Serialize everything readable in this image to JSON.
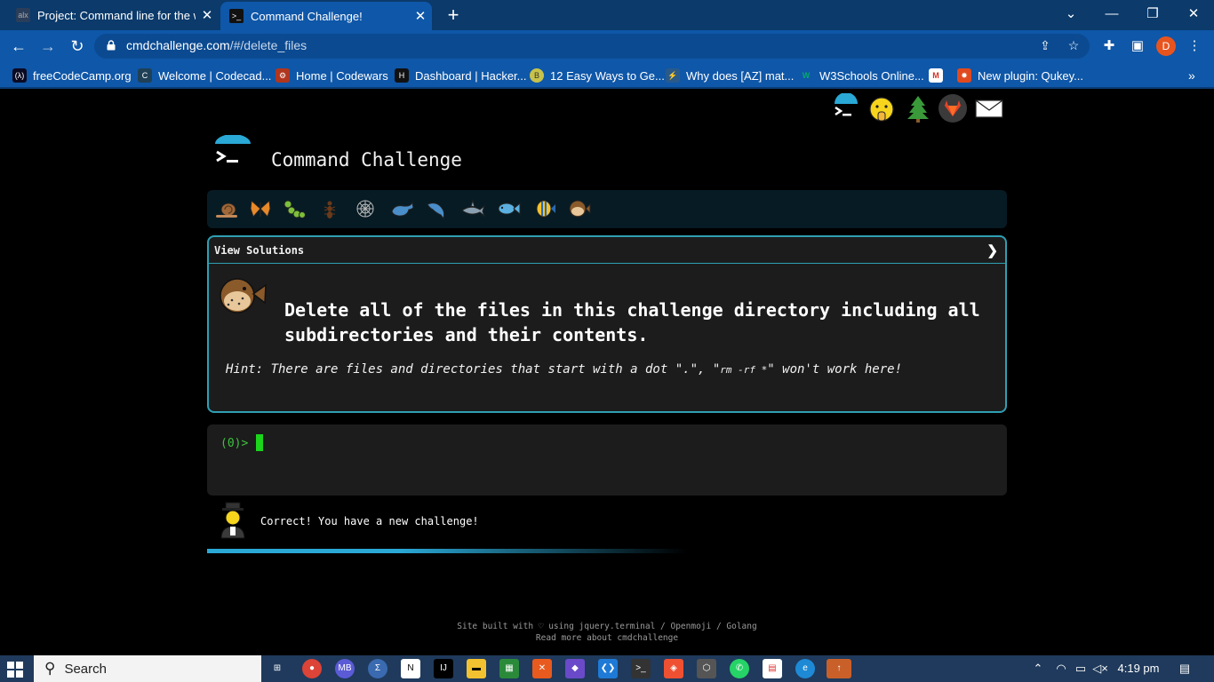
{
  "browser": {
    "tabs": [
      {
        "title": "Project: Command line for the wi",
        "favicon_text": "alx",
        "active": false
      },
      {
        "title": "Command Challenge!",
        "favicon_text": ">_",
        "active": true
      }
    ],
    "new_tab": "+",
    "url_host": "cmdchallenge.com",
    "url_path": "/#/delete_files",
    "profile_initial": "D",
    "bookmarks": [
      {
        "label": "freeCodeCamp.org",
        "icon": "fcc-icon",
        "icon_text": "(λ)",
        "color": "#0a0a23"
      },
      {
        "label": "Welcome | Codecad...",
        "icon": "codecademy-icon",
        "icon_text": "C",
        "color": "#1f4056"
      },
      {
        "label": "Home | Codewars",
        "icon": "codewars-icon",
        "icon_text": "⚙",
        "color": "#b1361e"
      },
      {
        "label": "Dashboard | Hacker...",
        "icon": "hackerrank-icon",
        "icon_text": "H",
        "color": "#111111"
      },
      {
        "label": "12 Easy Ways to Ge...",
        "icon": "article-icon",
        "icon_text": "B",
        "color": "#c8c24a"
      },
      {
        "label": "Why does [AZ] mat...",
        "icon": "stackoverflow-icon",
        "icon_text": "⚡",
        "color": "#2a5a8a"
      },
      {
        "label": "W3Schools Online...",
        "icon": "w3schools-icon",
        "icon_text": "W",
        "color": "#04aa6d"
      },
      {
        "label": "",
        "icon": "gmail-icon",
        "icon_text": "M",
        "color": "#ffffff"
      },
      {
        "label": "New plugin: Qukey...",
        "icon": "plugin-icon",
        "icon_text": "✸",
        "color": "#e04a1e"
      }
    ]
  },
  "page": {
    "title": "Command Challenge",
    "view_solutions": "View Solutions",
    "chevron": "❯",
    "task": "Delete all of the files in this challenge directory including all subdirectories and their contents.",
    "hint_prefix": "Hint: There are files and directories that start with a dot \".\", \"",
    "hint_code": "rm -rf *",
    "hint_suffix": "\" won't work here!",
    "prompt": "(0)>",
    "result": "Correct! You have a new challenge!",
    "progress": 0.6,
    "footer_line1": "Site built with ♡ using jquery.terminal / Openmoji / Golang",
    "footer_line2": "Read more about cmdchallenge"
  },
  "taskbar": {
    "search_placeholder": "Search",
    "time": "4:19 pm"
  },
  "colors": {
    "accent": "#2f9fb2",
    "prompt_green": "#3ec23e",
    "level_bar_bg": "#071b24",
    "chrome_blue": "#0f57a8"
  }
}
